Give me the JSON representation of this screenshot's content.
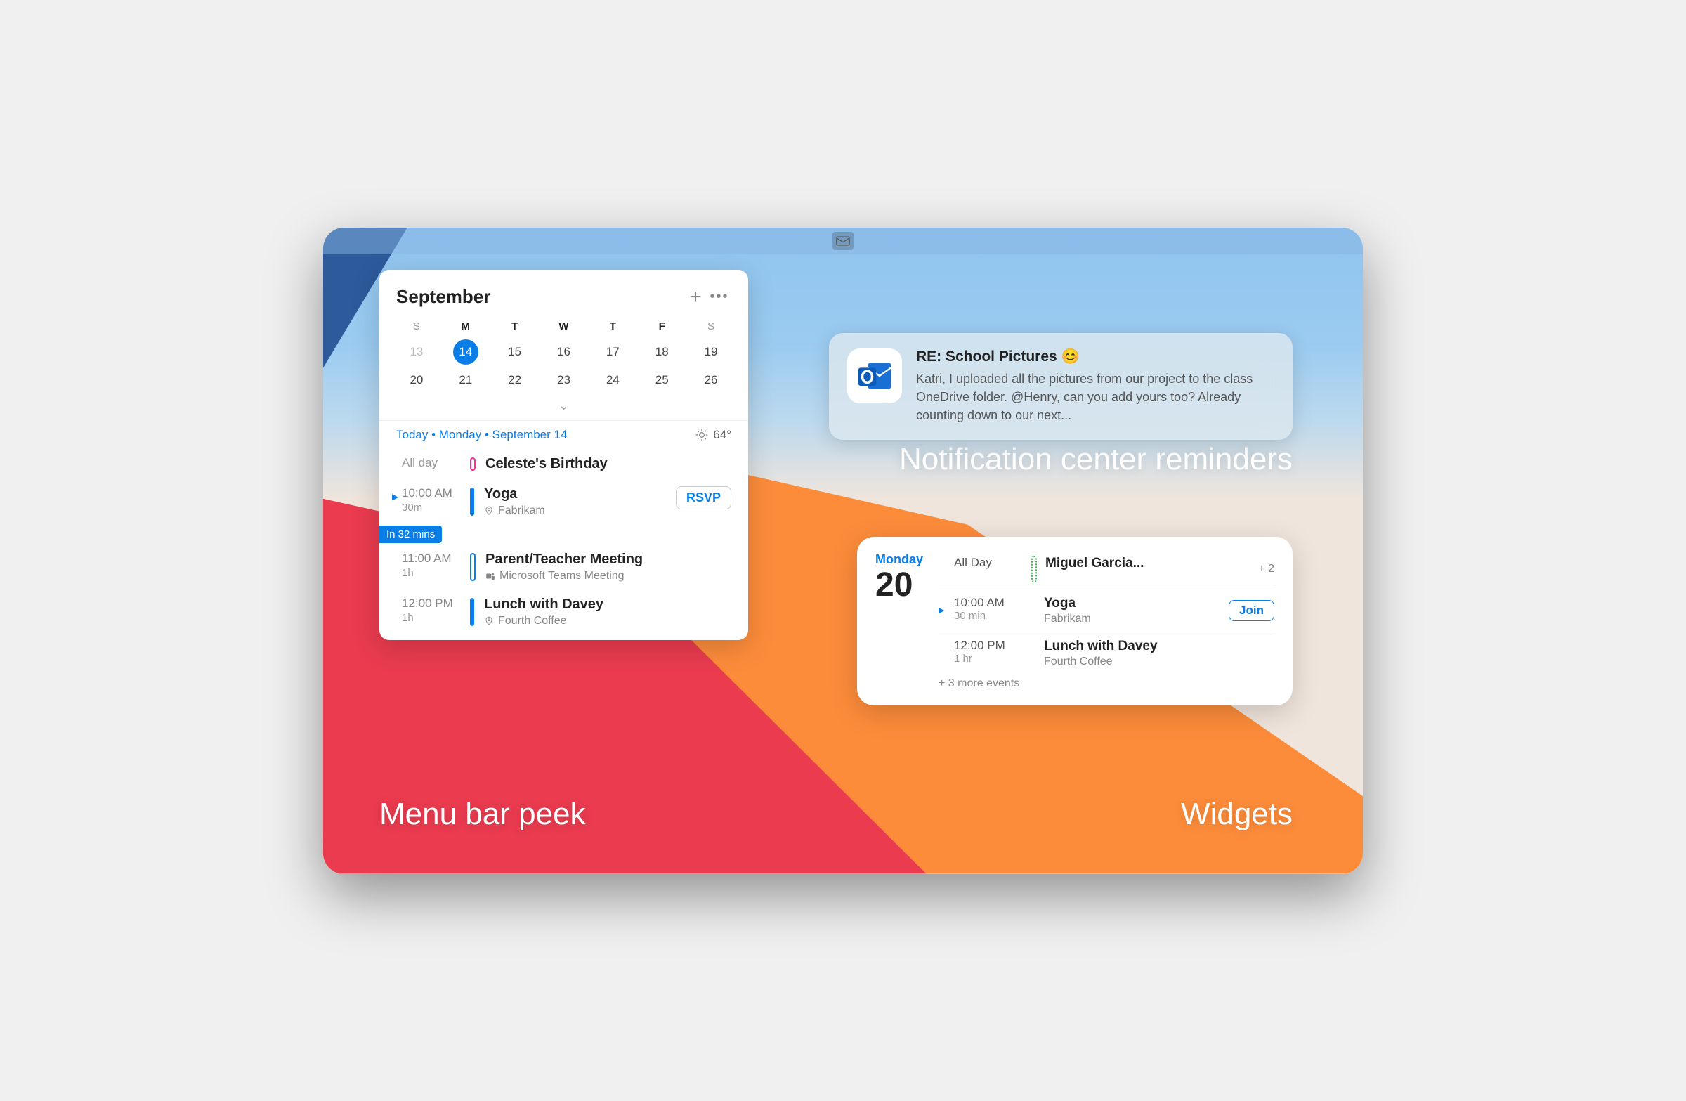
{
  "captions": {
    "menubar": "Menu bar peek",
    "notif": "Notification center reminders",
    "widgets": "Widgets"
  },
  "peek": {
    "month": "September",
    "dow": [
      "S",
      "M",
      "T",
      "W",
      "T",
      "F",
      "S"
    ],
    "dates": [
      "13",
      "14",
      "15",
      "16",
      "17",
      "18",
      "19",
      "20",
      "21",
      "22",
      "23",
      "24",
      "25",
      "26"
    ],
    "today_label": "Today • Monday • September 14",
    "weather": "64°",
    "events": [
      {
        "time": "All day",
        "dur": "",
        "title": "Celeste's Birthday",
        "loc": "",
        "bar": "pink"
      },
      {
        "time": "10:00 AM",
        "dur": "30m",
        "title": "Yoga",
        "loc": "Fabrikam",
        "bar": "blue",
        "rsvp": "RSVP",
        "caret": true
      },
      {
        "badge": "In 32 mins"
      },
      {
        "time": "11:00 AM",
        "dur": "1h",
        "title": "Parent/Teacher Meeting",
        "loc": "Microsoft Teams Meeting",
        "bar": "blue-o",
        "teams": true
      },
      {
        "time": "12:00 PM",
        "dur": "1h",
        "title": "Lunch with Davey",
        "loc": "Fourth Coffee",
        "bar": "blue"
      }
    ]
  },
  "notification": {
    "subject": "RE: School Pictures 😊",
    "body": "Katri, I uploaded all the pictures from our project to the class OneDrive folder. @Henry, can you add yours too? Already counting down to our next..."
  },
  "widget": {
    "day_name": "Monday",
    "day_num": "20",
    "rows": [
      {
        "time": "All Day",
        "dur": "",
        "title": "Miguel Garcia...",
        "loc": "",
        "bar": "green",
        "extra": "+ 2"
      },
      {
        "time": "10:00 AM",
        "dur": "30 min",
        "title": "Yoga",
        "loc": "Fabrikam",
        "bar": "blue",
        "join": "Join",
        "caret": true
      },
      {
        "time": "12:00 PM",
        "dur": "1 hr",
        "title": "Lunch with Davey",
        "loc": "Fourth Coffee",
        "bar": "blue"
      }
    ],
    "more": "+ 3 more events"
  }
}
